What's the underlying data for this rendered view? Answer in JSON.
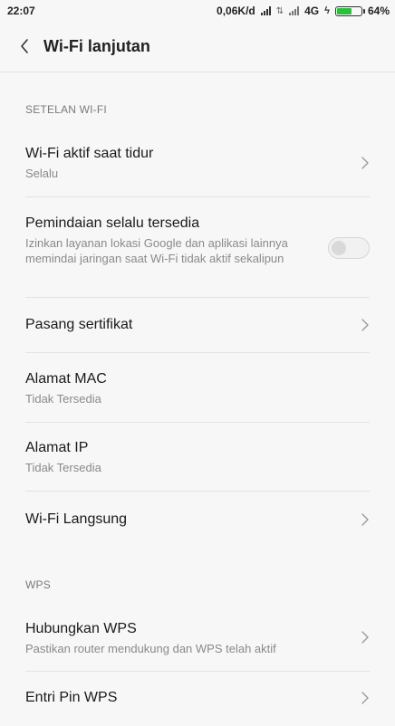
{
  "status_bar": {
    "time": "22:07",
    "speed": "0,06K/d",
    "network": "4G",
    "battery": "64%",
    "battery_level": 0.64,
    "battery_color": "#27c13a"
  },
  "header": {
    "back_icon": "chevron-left-icon",
    "title": "Wi-Fi lanjutan"
  },
  "sections": [
    {
      "label": "SETELAN WI-FI"
    },
    {
      "label": "WPS"
    }
  ],
  "items": [
    {
      "title": "Wi-Fi aktif saat tidur",
      "subtitle": "Selalu",
      "control": "chevron"
    },
    {
      "title": "Pemindaian selalu tersedia",
      "subtitle": "Izinkan layanan lokasi Google dan aplikasi lainnya memindai jaringan saat Wi-Fi tidak aktif sekalipun",
      "control": "toggle",
      "toggle_on": false
    },
    {
      "title": "Pasang sertifikat",
      "control": "chevron"
    },
    {
      "title": "Alamat MAC",
      "subtitle": "Tidak Tersedia",
      "control": "none"
    },
    {
      "title": "Alamat IP",
      "subtitle": "Tidak Tersedia",
      "control": "none"
    },
    {
      "title": "Wi-Fi Langsung",
      "control": "chevron"
    },
    {
      "title": "Hubungkan WPS",
      "subtitle": "Pastikan router mendukung dan WPS telah aktif",
      "control": "chevron"
    },
    {
      "title": "Entri Pin WPS",
      "control": "chevron"
    }
  ]
}
